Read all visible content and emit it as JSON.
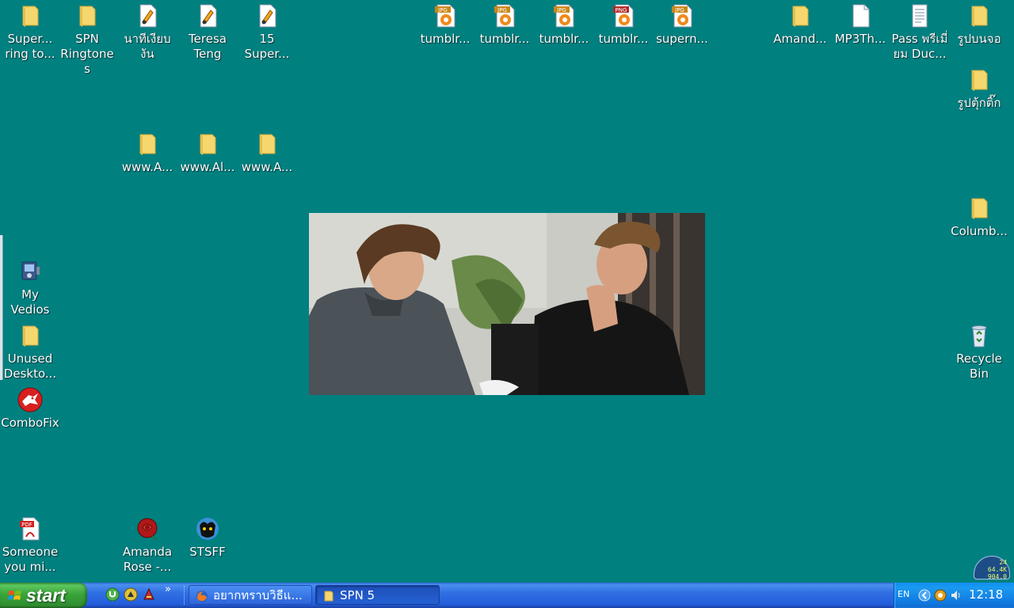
{
  "desktop": {
    "background_color": "#018080",
    "icons": [
      {
        "label": "Super... ring to...",
        "kind": "folder"
      },
      {
        "label": "SPN Ringtones",
        "kind": "folder"
      },
      {
        "label": "นาทีเงียบ งัน",
        "kind": "audio"
      },
      {
        "label": "Teresa Teng",
        "kind": "audio"
      },
      {
        "label": "15 Super...",
        "kind": "audio"
      },
      {
        "label": "tumblr...",
        "kind": "jpg"
      },
      {
        "label": "tumblr...",
        "kind": "jpg"
      },
      {
        "label": "tumblr...",
        "kind": "jpg"
      },
      {
        "label": "tumblr...",
        "kind": "png"
      },
      {
        "label": "supern...",
        "kind": "jpg"
      },
      {
        "label": "Amand...",
        "kind": "folder"
      },
      {
        "label": "MP3Th...",
        "kind": "file"
      },
      {
        "label": "Pass พรีเมี่ยม Duc...",
        "kind": "text"
      },
      {
        "label": "รูปบนจอ",
        "kind": "folder"
      },
      {
        "label": "รูปตุ้กติ๊ก",
        "kind": "folder"
      },
      {
        "label": "www.A...",
        "kind": "folder"
      },
      {
        "label": "www.Al...",
        "kind": "folder"
      },
      {
        "label": "www.A...",
        "kind": "folder"
      },
      {
        "label": "Columb...",
        "kind": "folder"
      },
      {
        "label": "My Vedios",
        "kind": "video"
      },
      {
        "label": "Unused Deskto...",
        "kind": "folder"
      },
      {
        "label": "ComboFix",
        "kind": "combofix"
      },
      {
        "label": "Recycle Bin",
        "kind": "recycle"
      },
      {
        "label": "Someone you mi...",
        "kind": "pdf"
      },
      {
        "label": "Amanda Rose -...",
        "kind": "rose"
      },
      {
        "label": "STSFF",
        "kind": "stsff"
      }
    ]
  },
  "taskbar": {
    "start_label": "start",
    "tasks": [
      {
        "label": "อยากทราบวิธีแ...",
        "icon": "firefox-icon"
      },
      {
        "label": "SPN 5",
        "icon": "folder-icon"
      }
    ],
    "tray": {
      "language": "EN",
      "clock": "12:18"
    },
    "net_widget": [
      "24",
      "64.4K",
      "904.0"
    ]
  }
}
